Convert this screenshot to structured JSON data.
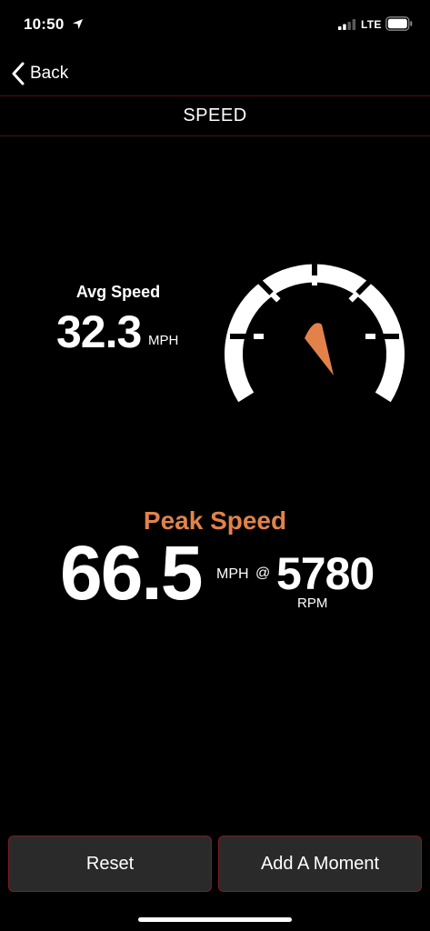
{
  "status_bar": {
    "time": "10:50",
    "network": "LTE",
    "icons": [
      "location-arrow-icon",
      "signal-icon",
      "battery-icon"
    ]
  },
  "nav": {
    "back_label": "Back",
    "title": "SPEED"
  },
  "avg": {
    "label": "Avg Speed",
    "value": "32.3",
    "unit": "MPH"
  },
  "gauge": {
    "icon": "speedometer-icon",
    "needle_color": "#e2824a",
    "dial_color": "#ffffff"
  },
  "peak": {
    "label": "Peak Speed",
    "value": "66.5",
    "unit": "MPH",
    "at": "@",
    "rpm_value": "5780",
    "rpm_unit": "RPM",
    "label_color": "#e2824a"
  },
  "actions": {
    "reset_label": "Reset",
    "moment_label": "Add A Moment",
    "border_color": "#7a1e1e"
  }
}
